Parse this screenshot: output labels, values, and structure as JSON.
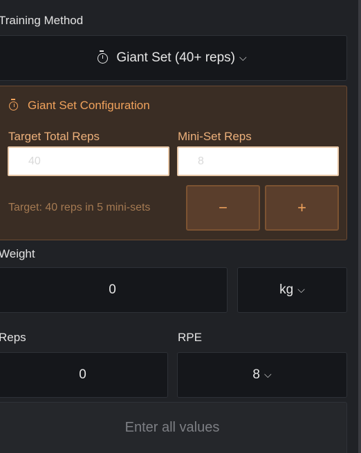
{
  "training_method": {
    "label": "Training Method",
    "selected": "Giant Set (40+ reps)",
    "icon": "stopwatch-icon",
    "chevron": "⌵"
  },
  "giant_set_config": {
    "title": "Giant Set Configuration",
    "target_total_reps_label": "Target Total Reps",
    "target_total_reps_placeholder": "40",
    "mini_set_reps_label": "Mini-Set Reps",
    "mini_set_reps_placeholder": "8",
    "target_summary": "Target: 40 reps in 5 mini-sets",
    "decrement_label": "−",
    "increment_label": "+",
    "accent_color": "#f0a25c"
  },
  "weight": {
    "label": "Weight",
    "value": "0",
    "unit": "kg"
  },
  "reps": {
    "label": "Reps",
    "value": "0"
  },
  "rpe": {
    "label": "RPE",
    "value": "8"
  },
  "submit": {
    "label": "Enter all values"
  }
}
